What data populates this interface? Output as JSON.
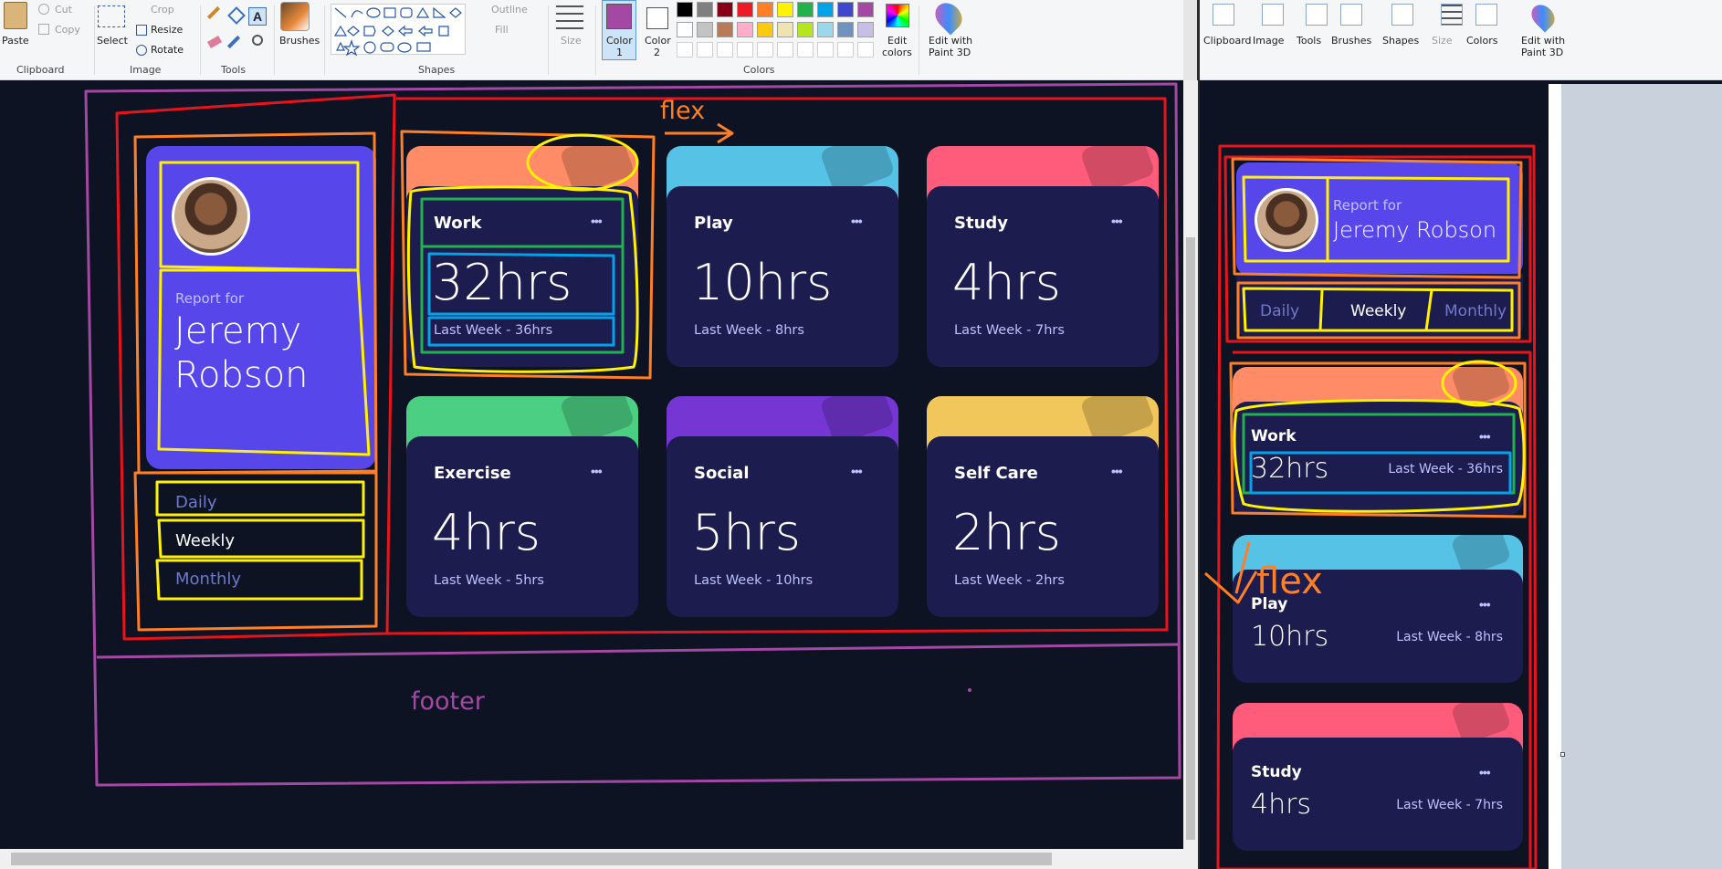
{
  "left_ribbon": {
    "clipboard": {
      "paste": "Paste",
      "cut": "Cut",
      "copy": "Copy",
      "group": "Clipboard"
    },
    "image": {
      "select": "Select",
      "crop": "Crop",
      "resize": "Resize",
      "rotate": "Rotate",
      "group": "Image"
    },
    "tools": {
      "group": "Tools"
    },
    "brushes": "Brushes",
    "shapes": {
      "group": "Shapes",
      "outline": "Outline",
      "fill": "Fill"
    },
    "size": "Size",
    "color1": "Color\n1",
    "color1_a": "Color",
    "color1_b": "1",
    "color2_a": "Color",
    "color2_b": "2",
    "colors_group": "Colors",
    "edit_colors_a": "Edit",
    "edit_colors_b": "colors",
    "edit3d_a": "Edit with",
    "edit3d_b": "Paint 3D",
    "palette": [
      "#000000",
      "#7f7f7f",
      "#880015",
      "#ed1c24",
      "#ff7f27",
      "#fff200",
      "#22b14c",
      "#00a2e8",
      "#3f48cc",
      "#a349a4",
      "#ffffff",
      "#c3c3c3",
      "#b97a57",
      "#ffaec9",
      "#ffc90e",
      "#efe4b0",
      "#b5e61d",
      "#99d9ea",
      "#7092be",
      "#c8bfe7"
    ],
    "active_color": "#a349a4"
  },
  "right_ribbon": {
    "items": [
      "Clipboard",
      "Image",
      "Tools",
      "Brushes",
      "Shapes",
      "Size",
      "Colors"
    ],
    "edit3d_a": "Edit with",
    "edit3d_b": "Paint 3D"
  },
  "desktop": {
    "profile": {
      "report_for": "Report for",
      "first": "Jeremy",
      "last": "Robson"
    },
    "tabs": [
      "Daily",
      "Weekly",
      "Monthly"
    ],
    "cards": [
      {
        "title": "Work",
        "hrs": "32hrs",
        "last": "Last Week - 36hrs",
        "color": "#ff8c66"
      },
      {
        "title": "Play",
        "hrs": "10hrs",
        "last": "Last Week - 8hrs",
        "color": "#56c2e6"
      },
      {
        "title": "Study",
        "hrs": "4hrs",
        "last": "Last Week - 7hrs",
        "color": "#ff5c7c"
      },
      {
        "title": "Exercise",
        "hrs": "4hrs",
        "last": "Last Week - 5hrs",
        "color": "#4bcf83"
      },
      {
        "title": "Social",
        "hrs": "5hrs",
        "last": "Last Week - 10hrs",
        "color": "#7536d3"
      },
      {
        "title": "Self Care",
        "hrs": "2hrs",
        "last": "Last Week - 2hrs",
        "color": "#f1c65b"
      }
    ],
    "annotation_flex": "flex",
    "annotation_footer": "footer"
  },
  "mobile": {
    "profile": {
      "report_for": "Report for",
      "name": "Jeremy Robson"
    },
    "tabs": [
      "Daily",
      "Weekly",
      "Monthly"
    ],
    "cards": [
      {
        "title": "Work",
        "hrs": "32hrs",
        "last": "Last Week - 36hrs"
      },
      {
        "title": "Play",
        "hrs": "10hrs",
        "last": "Last Week - 8hrs"
      },
      {
        "title": "Study",
        "hrs": "4hrs",
        "last": "Last Week - 7hrs"
      }
    ],
    "annotation_flex": "flex"
  },
  "colors": {
    "bg": "#0d1323",
    "card": "#1d1c4f",
    "profile": "#5747ea",
    "muted": "#bdc1ff",
    "annot_red": "#e8141b",
    "annot_orange": "#ff7f27",
    "annot_yellow": "#fff200",
    "annot_purple": "#a349a4",
    "annot_green": "#22b14c",
    "annot_blue": "#00a2e8"
  }
}
